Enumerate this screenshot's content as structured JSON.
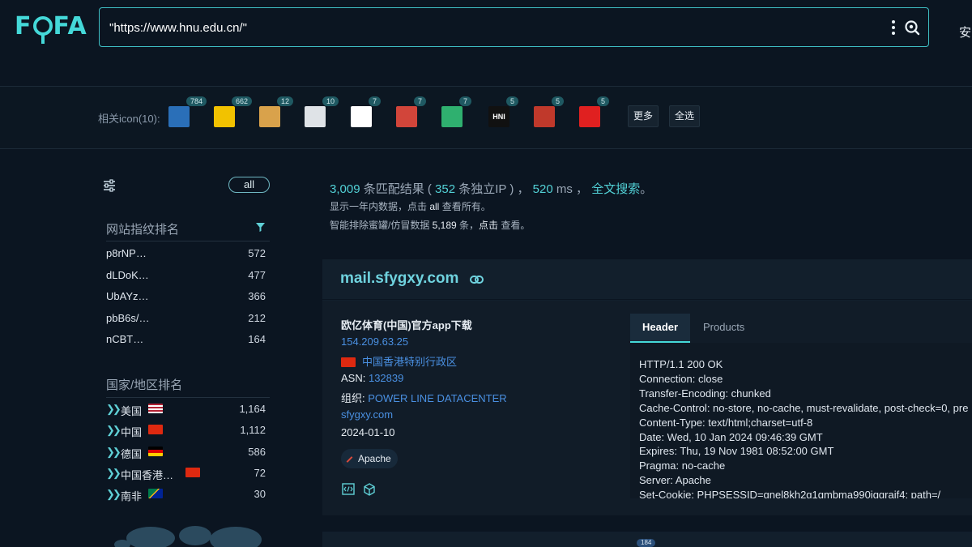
{
  "header": {
    "logo": "FOFA",
    "query": "\"https://www.hnu.edu.cn/\"",
    "right_text": "安"
  },
  "icons_bar": {
    "label": "相关icon(10):",
    "icons": [
      {
        "count": "784",
        "color": "#2a6fb8"
      },
      {
        "count": "662",
        "color": "#f2c200"
      },
      {
        "count": "12",
        "color": "#d9a24b"
      },
      {
        "count": "10",
        "color": "#dfe3e7"
      },
      {
        "count": "7",
        "color": "#ffffff"
      },
      {
        "count": "7",
        "color": "#d2453a"
      },
      {
        "count": "7",
        "color": "#2fb06f"
      },
      {
        "count": "5",
        "color": "#111111",
        "text": "HNI"
      },
      {
        "count": "5",
        "color": "#c0392b"
      },
      {
        "count": "5",
        "color": "#e02020"
      }
    ],
    "more_label": "更多",
    "select_all_label": "全选"
  },
  "sidebar": {
    "all_label": "all",
    "fingerprint_title": "网站指纹排名",
    "fingerprints": [
      {
        "name": "p8rNP…",
        "count": "572"
      },
      {
        "name": "dLDoK…",
        "count": "477"
      },
      {
        "name": "UbAYz…",
        "count": "366"
      },
      {
        "name": "pbB6s/…",
        "count": "212"
      },
      {
        "name": "nCBT…",
        "count": "164"
      }
    ],
    "country_title": "国家/地区排名",
    "countries": [
      {
        "name": "美国",
        "count": "1,164",
        "flag": "us"
      },
      {
        "name": "中国",
        "count": "1,112",
        "flag": "cn"
      },
      {
        "name": "德国",
        "count": "586",
        "flag": "de"
      },
      {
        "name": "中国香港…",
        "count": "72",
        "flag": "hk"
      },
      {
        "name": "南非",
        "count": "30",
        "flag": "za"
      }
    ]
  },
  "summary": {
    "total": "3,009",
    "matched_text": " 条匹配结果 ( ",
    "unique_ip": "352",
    "unique_ip_text": " 条独立IP ) ，",
    "time": "520",
    "time_unit": " ms ，",
    "full_search": "全文搜索",
    "full_search_end": "。",
    "line2_pre": "显示一年内数据，点击 ",
    "line2_link": "all",
    "line2_post": " 查看所有。",
    "line3_pre": "智能排除蜜罐/仿冒数据 ",
    "line3_count": "5,189",
    "line3_mid": " 条，",
    "line3_link": "点击",
    "line3_post": " 查看。"
  },
  "result": {
    "host": "mail.sfygxy.com",
    "title": "欧亿体育(中国)官方app下载",
    "ip": "154.209.63.25",
    "location": "中国香港特别行政区",
    "asn_label": "ASN: ",
    "asn": "132839",
    "org_label": "组织: ",
    "org": "POWER LINE DATACENTER",
    "domain": "sfygxy.com",
    "date": "2024-01-10",
    "tag": "Apache",
    "tabs": [
      "Header",
      "Products"
    ],
    "header_lines": [
      "HTTP/1.1 200 OK",
      "Connection: close",
      "Transfer-Encoding: chunked",
      "Cache-Control: no-store, no-cache, must-revalidate, post-check=0, pre",
      "Content-Type: text/html;charset=utf-8",
      "Date: Wed, 10 Jan 2024 09:46:39 GMT",
      "Expires: Thu, 19 Nov 1981 08:52:00 GMT",
      "Pragma: no-cache",
      "Server: Apache",
      "Set-Cookie: PHPSESSID=gnel8kh2g1gmbma990iggraif4; path=/"
    ]
  },
  "next_card": {
    "badge": "184"
  }
}
